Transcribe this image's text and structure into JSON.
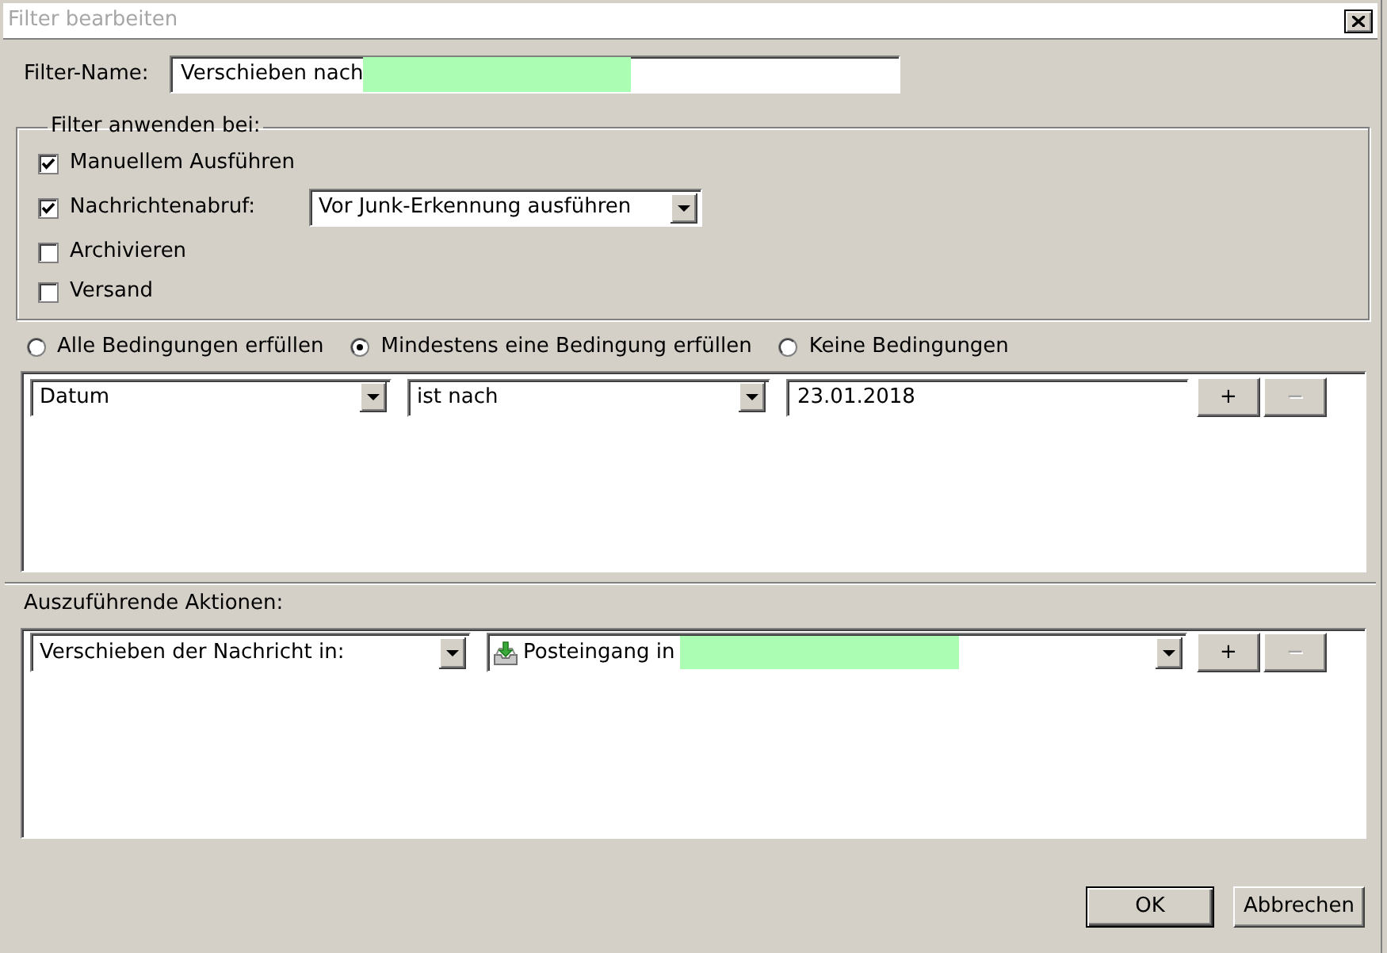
{
  "window": {
    "title": "Filter bearbeiten"
  },
  "filter_name": {
    "label": "Filter-Name:",
    "value": "Verschieben nach",
    "redacted": true
  },
  "apply_when": {
    "legend": "Filter anwenden bei:",
    "options": [
      {
        "label": "Manuellem Ausführen",
        "checked": true
      },
      {
        "label": "Nachrichtenabruf:",
        "checked": true,
        "dropdown": "Vor Junk-Erkennung ausführen"
      },
      {
        "label": "Archivieren",
        "checked": false
      },
      {
        "label": "Versand",
        "checked": false
      }
    ]
  },
  "match_options": [
    {
      "label": "Alle Bedingungen erfüllen",
      "selected": false
    },
    {
      "label": "Mindestens eine Bedingung erfüllen",
      "selected": true
    },
    {
      "label": "Keine Bedingungen",
      "selected": false
    }
  ],
  "conditions": [
    {
      "field": "Datum",
      "operator": "ist nach",
      "value": "23.01.2018",
      "buttons": [
        {
          "label": "+",
          "disabled": false
        },
        {
          "label": "−",
          "disabled": true
        }
      ]
    }
  ],
  "actions": {
    "label": "Auszuführende Aktionen:",
    "rows": [
      {
        "action": "Verschieben der Nachricht in:",
        "target": "Posteingang in",
        "target_redacted": true,
        "buttons": [
          {
            "label": "+",
            "disabled": false
          },
          {
            "label": "−",
            "disabled": true
          }
        ]
      }
    ]
  },
  "buttons": [
    {
      "label": "OK",
      "default": true
    },
    {
      "label": "Abbrechen",
      "default": false
    }
  ]
}
